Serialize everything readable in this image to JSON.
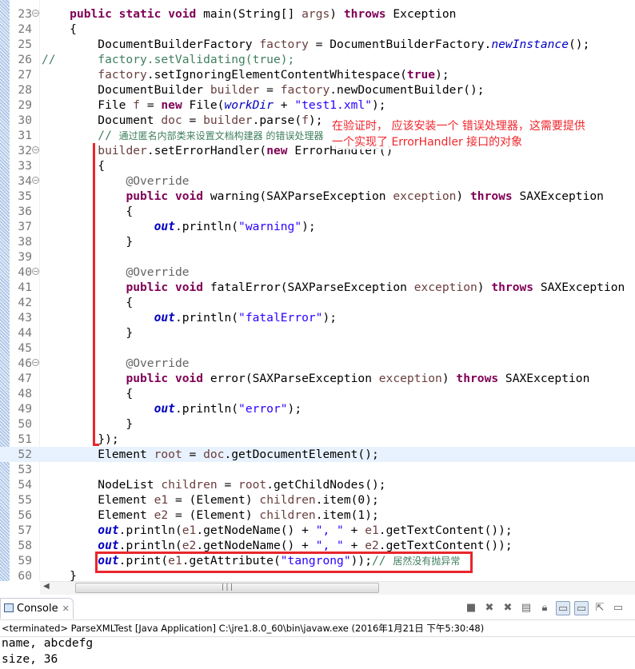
{
  "editor": {
    "current_line": 52,
    "fold_lines": [
      23,
      32,
      34,
      40,
      46
    ],
    "lines": [
      {
        "n": 23,
        "t": [
          [
            "    ",
            ""
          ],
          [
            "public",
            "kw"
          ],
          [
            " ",
            ""
          ],
          [
            "static",
            "kw"
          ],
          [
            " ",
            ""
          ],
          [
            "void",
            "kw"
          ],
          [
            " main(String[] ",
            ""
          ],
          [
            "args",
            "var"
          ],
          [
            ") ",
            ""
          ],
          [
            "throws",
            "kw"
          ],
          [
            " Exception",
            ""
          ]
        ]
      },
      {
        "n": 24,
        "t": [
          [
            "    {",
            ""
          ]
        ]
      },
      {
        "n": 25,
        "t": [
          [
            "        DocumentBuilderFactory ",
            ""
          ],
          [
            "factory",
            "var"
          ],
          [
            " = DocumentBuilderFactory.",
            ""
          ],
          [
            "newInstance",
            "it"
          ],
          [
            "();",
            ""
          ]
        ]
      },
      {
        "n": 26,
        "t": [
          [
            "//      factory.setValidating(true);",
            "cmt"
          ]
        ]
      },
      {
        "n": 27,
        "t": [
          [
            "        ",
            ""
          ],
          [
            "factory",
            "var"
          ],
          [
            ".setIgnoringElementContentWhitespace(",
            ""
          ],
          [
            "true",
            "kw"
          ],
          [
            ");",
            ""
          ]
        ]
      },
      {
        "n": 28,
        "t": [
          [
            "        DocumentBuilder ",
            ""
          ],
          [
            "builder",
            "var"
          ],
          [
            " = ",
            ""
          ],
          [
            "factory",
            "var"
          ],
          [
            ".newDocumentBuilder();",
            ""
          ]
        ]
      },
      {
        "n": 29,
        "t": [
          [
            "        File ",
            ""
          ],
          [
            "f",
            "var"
          ],
          [
            " = ",
            ""
          ],
          [
            "new",
            "kw"
          ],
          [
            " File(",
            ""
          ],
          [
            "workDir",
            "it"
          ],
          [
            " + ",
            ""
          ],
          [
            "\"test1.xml\"",
            "str"
          ],
          [
            ");",
            ""
          ]
        ]
      },
      {
        "n": 30,
        "t": [
          [
            "        Document ",
            ""
          ],
          [
            "doc",
            "var"
          ],
          [
            " = ",
            ""
          ],
          [
            "builder",
            "var"
          ],
          [
            ".parse(",
            ""
          ],
          [
            "f",
            "var"
          ],
          [
            ");",
            ""
          ]
        ]
      },
      {
        "n": 31,
        "t": [
          [
            "        // ",
            "cmt"
          ],
          [
            "通过匿名内部类来设置文档构建器 的错误处理器",
            "cmt cjk"
          ]
        ]
      },
      {
        "n": 32,
        "t": [
          [
            "        ",
            ""
          ],
          [
            "builder",
            "var"
          ],
          [
            ".setErrorHandler(",
            ""
          ],
          [
            "new",
            "kw"
          ],
          [
            " ErrorHandler()",
            ""
          ]
        ]
      },
      {
        "n": 33,
        "t": [
          [
            "        {",
            ""
          ]
        ]
      },
      {
        "n": 34,
        "t": [
          [
            "            ",
            ""
          ],
          [
            "@Override",
            "ann"
          ]
        ]
      },
      {
        "n": 35,
        "t": [
          [
            "            ",
            ""
          ],
          [
            "public",
            "kw"
          ],
          [
            " ",
            ""
          ],
          [
            "void",
            "kw"
          ],
          [
            " warning(SAXParseException ",
            ""
          ],
          [
            "exception",
            "var"
          ],
          [
            ") ",
            ""
          ],
          [
            "throws",
            "kw"
          ],
          [
            " SAXException",
            ""
          ]
        ]
      },
      {
        "n": 36,
        "t": [
          [
            "            {",
            ""
          ]
        ]
      },
      {
        "n": 37,
        "t": [
          [
            "                ",
            ""
          ],
          [
            "out",
            "fld"
          ],
          [
            ".println(",
            ""
          ],
          [
            "\"warning\"",
            "str"
          ],
          [
            ");",
            ""
          ]
        ]
      },
      {
        "n": 38,
        "t": [
          [
            "            }",
            ""
          ]
        ]
      },
      {
        "n": 39,
        "t": [
          [
            "",
            ""
          ]
        ]
      },
      {
        "n": 40,
        "t": [
          [
            "            ",
            ""
          ],
          [
            "@Override",
            "ann"
          ]
        ]
      },
      {
        "n": 41,
        "t": [
          [
            "            ",
            ""
          ],
          [
            "public",
            "kw"
          ],
          [
            " ",
            ""
          ],
          [
            "void",
            "kw"
          ],
          [
            " fatalError(SAXParseException ",
            ""
          ],
          [
            "exception",
            "var"
          ],
          [
            ") ",
            ""
          ],
          [
            "throws",
            "kw"
          ],
          [
            " SAXException",
            ""
          ]
        ]
      },
      {
        "n": 42,
        "t": [
          [
            "            {",
            ""
          ]
        ]
      },
      {
        "n": 43,
        "t": [
          [
            "                ",
            ""
          ],
          [
            "out",
            "fld"
          ],
          [
            ".println(",
            ""
          ],
          [
            "\"fatalError\"",
            "str"
          ],
          [
            ");",
            ""
          ]
        ]
      },
      {
        "n": 44,
        "t": [
          [
            "            }",
            ""
          ]
        ]
      },
      {
        "n": 45,
        "t": [
          [
            "",
            ""
          ]
        ]
      },
      {
        "n": 46,
        "t": [
          [
            "            ",
            ""
          ],
          [
            "@Override",
            "ann"
          ]
        ]
      },
      {
        "n": 47,
        "t": [
          [
            "            ",
            ""
          ],
          [
            "public",
            "kw"
          ],
          [
            " ",
            ""
          ],
          [
            "void",
            "kw"
          ],
          [
            " error(SAXParseException ",
            ""
          ],
          [
            "exception",
            "var"
          ],
          [
            ") ",
            ""
          ],
          [
            "throws",
            "kw"
          ],
          [
            " SAXException",
            ""
          ]
        ]
      },
      {
        "n": 48,
        "t": [
          [
            "            {",
            ""
          ]
        ]
      },
      {
        "n": 49,
        "t": [
          [
            "                ",
            ""
          ],
          [
            "out",
            "fld"
          ],
          [
            ".println(",
            ""
          ],
          [
            "\"error\"",
            "str"
          ],
          [
            ");",
            ""
          ]
        ]
      },
      {
        "n": 50,
        "t": [
          [
            "            }",
            ""
          ]
        ]
      },
      {
        "n": 51,
        "t": [
          [
            "        });",
            ""
          ]
        ]
      },
      {
        "n": 52,
        "t": [
          [
            "        Element ",
            ""
          ],
          [
            "root",
            "var"
          ],
          [
            " = ",
            ""
          ],
          [
            "doc",
            "var"
          ],
          [
            ".getDocumentElement();",
            ""
          ]
        ]
      },
      {
        "n": 53,
        "t": [
          [
            "",
            ""
          ]
        ]
      },
      {
        "n": 54,
        "t": [
          [
            "        NodeList ",
            ""
          ],
          [
            "children",
            "var"
          ],
          [
            " = ",
            ""
          ],
          [
            "root",
            "var"
          ],
          [
            ".getChildNodes();",
            ""
          ]
        ]
      },
      {
        "n": 55,
        "t": [
          [
            "        Element ",
            ""
          ],
          [
            "e1",
            "var"
          ],
          [
            " = (Element) ",
            ""
          ],
          [
            "children",
            "var"
          ],
          [
            ".item(0);",
            ""
          ]
        ]
      },
      {
        "n": 56,
        "t": [
          [
            "        Element ",
            ""
          ],
          [
            "e2",
            "var"
          ],
          [
            " = (Element) ",
            ""
          ],
          [
            "children",
            "var"
          ],
          [
            ".item(1);",
            ""
          ]
        ]
      },
      {
        "n": 57,
        "t": [
          [
            "        ",
            ""
          ],
          [
            "out",
            "fld"
          ],
          [
            ".println(",
            ""
          ],
          [
            "e1",
            "var"
          ],
          [
            ".getNodeName() + ",
            ""
          ],
          [
            "\", \"",
            "str"
          ],
          [
            " + ",
            ""
          ],
          [
            "e1",
            "var"
          ],
          [
            ".getTextContent());",
            ""
          ]
        ]
      },
      {
        "n": 58,
        "t": [
          [
            "        ",
            ""
          ],
          [
            "out",
            "fld"
          ],
          [
            ".println(",
            ""
          ],
          [
            "e2",
            "var"
          ],
          [
            ".getNodeName() + ",
            ""
          ],
          [
            "\", \"",
            "str"
          ],
          [
            " + ",
            ""
          ],
          [
            "e2",
            "var"
          ],
          [
            ".getTextContent());",
            ""
          ]
        ]
      },
      {
        "n": 59,
        "t": [
          [
            "        ",
            ""
          ],
          [
            "out",
            "fld"
          ],
          [
            ".print(",
            ""
          ],
          [
            "e1",
            "var"
          ],
          [
            ".getAttribute(",
            ""
          ],
          [
            "\"tangrong\"",
            "str"
          ],
          [
            "));",
            ""
          ],
          [
            "// ",
            "cmt"
          ],
          [
            "居然没有抛异常",
            "cmt cjk"
          ]
        ]
      },
      {
        "n": 60,
        "t": [
          [
            "    }",
            ""
          ]
        ]
      }
    ]
  },
  "annotation": {
    "line1": "在验证时， 应该安装一个 错误处理器，这需要提供",
    "line2": "一个实现了 ErrorHandler 接口的对象",
    "color": "#f0262c"
  },
  "console": {
    "tab_label": "Console",
    "status": "<terminated> ParseXMLTest [Java Application] C:\\jre1.8.0_60\\bin\\javaw.exe (2016年1月21日 下午5:30:48)",
    "output": [
      "name, abcdefg",
      "size, 36"
    ]
  }
}
